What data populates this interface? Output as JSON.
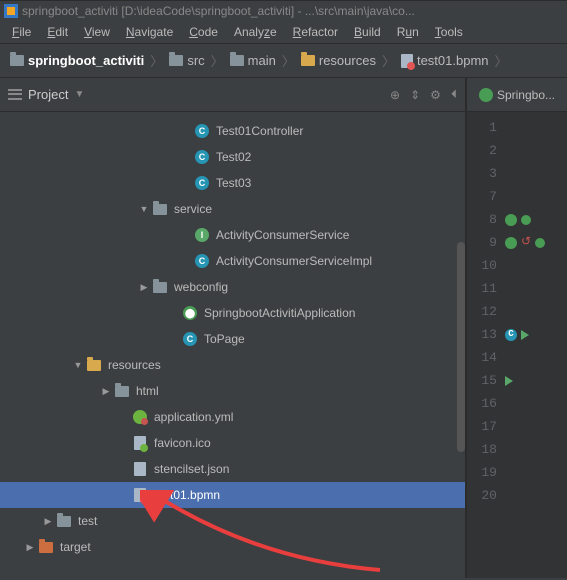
{
  "title": "springboot_activiti [D:\\ideaCode\\springboot_activiti] - ...\\src\\main\\java\\co...",
  "menu": {
    "file": "File",
    "edit": "Edit",
    "view": "View",
    "navigate": "Navigate",
    "code": "Code",
    "analyze": "Analyze",
    "refactor": "Refactor",
    "build": "Build",
    "run": "Run",
    "tools": "Tools"
  },
  "breadcrumb": {
    "project": "springboot_activiti",
    "items": [
      "src",
      "main",
      "resources",
      "test01.bpmn"
    ]
  },
  "projectPanel": {
    "title": "Project"
  },
  "tree": {
    "n0": "Test01Controller",
    "n1": "Test02",
    "n2": "Test03",
    "n3": "service",
    "n4": "ActivityConsumerService",
    "n5": "ActivityConsumerServiceImpl",
    "n6": "webconfig",
    "n7": "SpringbootActivitiApplication",
    "n8": "ToPage",
    "n9": "resources",
    "n10": "html",
    "n11": "application.yml",
    "n12": "favicon.ico",
    "n13": "stencilset.json",
    "n14": "test01.bpmn",
    "n15": "test",
    "n16": "target"
  },
  "editor": {
    "tab": "Springbo..."
  },
  "gutter": [
    "1",
    "2",
    "3",
    "7",
    "8",
    "9",
    "10",
    "11",
    "12",
    "13",
    "14",
    "15",
    "16",
    "17",
    "18",
    "19",
    "20"
  ]
}
